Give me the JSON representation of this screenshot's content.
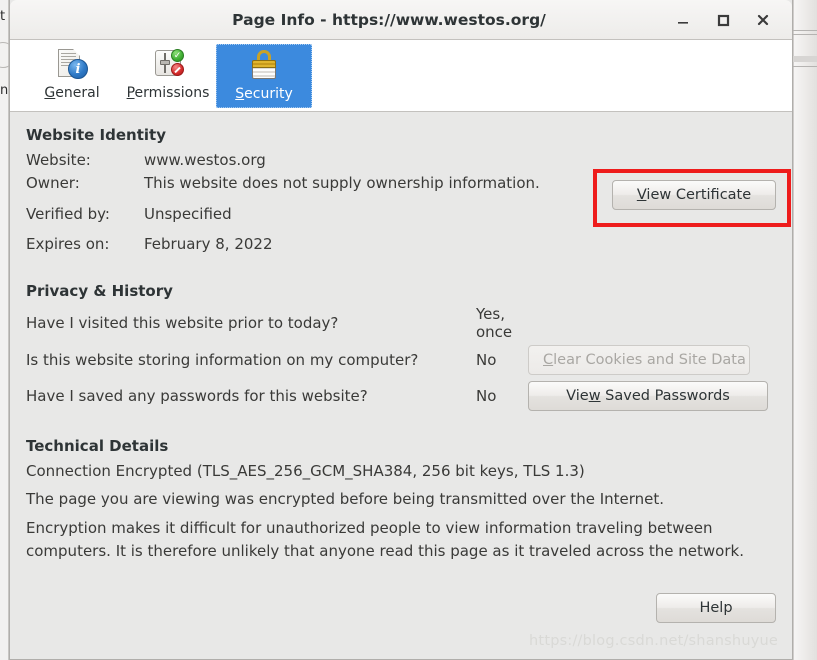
{
  "window": {
    "title": "Page Info - https://www.westos.org/",
    "controls": {
      "minimize": "minimize-icon",
      "maximize": "maximize-icon",
      "close": "close-icon"
    }
  },
  "tabs": [
    {
      "id": "general",
      "label": "General",
      "mnemonic": "G",
      "icon": "document-info-icon",
      "selected": false
    },
    {
      "id": "permissions",
      "label": "Permissions",
      "mnemonic": "P",
      "icon": "permissions-icon",
      "selected": false
    },
    {
      "id": "security",
      "label": "Security",
      "mnemonic": "S",
      "icon": "padlock-icon",
      "selected": true
    }
  ],
  "identity": {
    "heading": "Website Identity",
    "rows": [
      {
        "label": "Website:",
        "value": "www.westos.org"
      },
      {
        "label": "Owner:",
        "value": "This website does not supply ownership information."
      },
      {
        "label": "Verified by:",
        "value": "Unspecified"
      },
      {
        "label": "Expires on:",
        "value": "February 8, 2022"
      }
    ],
    "view_certificate_button": "View Certificate",
    "view_certificate_mnemonic": "V"
  },
  "privacy": {
    "heading": "Privacy & History",
    "rows": [
      {
        "question": "Have I visited this website prior to today?",
        "answer": "Yes, once",
        "button": null
      },
      {
        "question": "Is this website storing information on my computer?",
        "answer": "No",
        "button": "Clear Cookies and Site Data",
        "button_mnemonic": "C",
        "button_disabled": true
      },
      {
        "question": "Have I saved any passwords for this website?",
        "answer": "No",
        "button": "View Saved Passwords",
        "button_mnemonic": "w",
        "button_disabled": false
      }
    ]
  },
  "technical": {
    "heading": "Technical Details",
    "connection": "Connection Encrypted (TLS_AES_256_GCM_SHA384, 256 bit keys, TLS 1.3)",
    "line2": "The page you are viewing was encrypted before being transmitted over the Internet.",
    "paragraph": "Encryption makes it difficult for unauthorized people to view information traveling between computers. It is therefore unlikely that anyone read this page as it traveled across the network."
  },
  "footer": {
    "help_button": "Help",
    "watermark": "https://blog.csdn.net/shanshuyue"
  },
  "backdrop": {
    "left_glyphs": [
      "t",
      "n"
    ]
  },
  "colors": {
    "selected_tab": "#3c8ade",
    "annotation": "#ee1c1c",
    "dialog_bg": "#e8e8e7",
    "titlebar_bg": "#f2f1ef",
    "text": "#3a3a38",
    "disabled_text": "#a9a7a3",
    "watermark": "#d9d9d6"
  }
}
